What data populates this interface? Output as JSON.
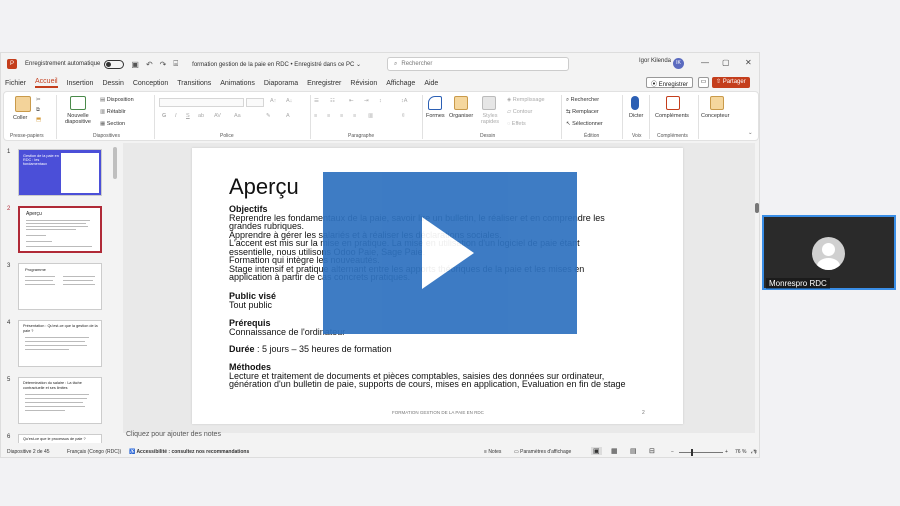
{
  "title_bar": {
    "app_icon": "powerpoint-icon",
    "autosave_label": "Enregistrement automatique",
    "filename": "formation gestion de la paie en RDC • Enregistré dans ce PC ⌄",
    "search_placeholder": "Rechercher",
    "user_name": "Igor Kilenda",
    "user_initials": "IK"
  },
  "menu": {
    "items": [
      "Fichier",
      "Accueil",
      "Insertion",
      "Dessin",
      "Conception",
      "Transitions",
      "Animations",
      "Diaporama",
      "Enregistrer",
      "Révision",
      "Affichage",
      "Aide"
    ],
    "active": "Accueil",
    "save_button": "Enregistrer",
    "share_button": "Partager"
  },
  "ribbon": {
    "paste": "Coller",
    "new_slide": "Nouvelle diapositive",
    "layout": "Disposition",
    "reset": "Rétablir",
    "section": "Section",
    "clipboard_group": "Presse-papiers",
    "slides_group": "Diapositives",
    "font_group": "Police",
    "paragraph_group": "Paragraphe",
    "shapes": "Formes",
    "arrange": "Organiser",
    "quick_styles": "Styles rapides",
    "fill": "Remplissage",
    "outline": "Contour",
    "effects": "Effets",
    "drawing_group": "Dessin",
    "find": "Rechercher",
    "replace": "Remplacer",
    "select": "Sélectionner",
    "editing_group": "Édition",
    "dictate": "Dicter",
    "voice_group": "Voix",
    "addins": "Compléments",
    "addins_group": "Compléments",
    "designer": "Concepteur"
  },
  "thumbnails": [
    {
      "num": "1",
      "title": "Gestion de la paie en RDC : les fondamentaux"
    },
    {
      "num": "2",
      "title": "Aperçu"
    },
    {
      "num": "3",
      "title": "Programme"
    },
    {
      "num": "4",
      "title": "Présentation : Qu'est-ce que la gestion de la paie ?"
    },
    {
      "num": "5",
      "title": "Détermination du salaire : La tâche contractuelle et ses limites"
    },
    {
      "num": "6",
      "title": "Qu'est-ce que le processus de paie ?"
    }
  ],
  "slide": {
    "title": "Aperçu",
    "objectives_heading": "Objectifs",
    "objectives_lines": [
      "Reprendre les fondamentaux de la paie, savoir lire un bulletin, le réaliser et en comprendre les",
      "grandes rubriques.",
      "Apprendre à gérer les salariés et à réaliser les déclarations sociales.",
      "L'accent est mis sur la mise en pratique. La mise en utilisation d'un logiciel de paie étant",
      "essentielle, nous utilisons Odoo Paie, Sage Paie.",
      "Formation qui intègre les nouveautés.",
      "Stage intensif et pratique alternant entre les apports théoriques de la paie et les mises en",
      "application à partir de cas concrets pratiques."
    ],
    "audience_heading": "Public visé",
    "audience": "Tout public",
    "prereq_heading": "Prérequis",
    "prereq": "Connaissance de l'ordinateur",
    "duration_label": "Durée",
    "duration_value": " : 5 jours – 35 heures de formation",
    "methods_heading": "Méthodes",
    "methods_lines": [
      "Lecture et traitement de documents et pièces comptables, saisies des données sur ordinateur,",
      "génération d'un bulletin de paie, supports de cours, mises en application, Evaluation en fin de stage"
    ],
    "footer": "FORMATION GESTION DE LA PAIE EN RDC",
    "slide_number": "2"
  },
  "notes_placeholder": "Cliquez pour ajouter des notes",
  "status": {
    "slide_count": "Diapositive 2 de 45",
    "language": "Français (Congo (RDC))",
    "accessibility": "Accessibilité : consultez nos recommandations",
    "notes": "Notes",
    "display_settings": "Paramètres d'affichage",
    "zoom": "76 %"
  },
  "participant": {
    "name": "Monrespro RDC"
  },
  "colors": {
    "accent": "#c43e1c",
    "video_overlay": "#2f72c0",
    "participant_border": "#3a8ee6"
  }
}
